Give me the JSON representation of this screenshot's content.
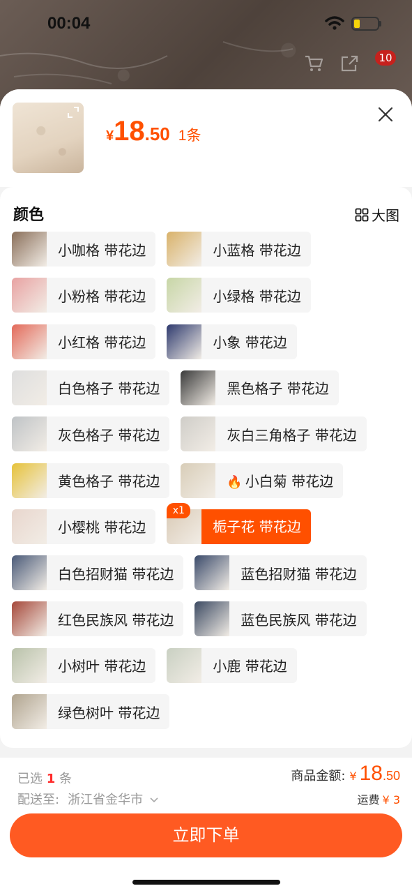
{
  "status_bar": {
    "time": "00:04"
  },
  "top_bar": {
    "cart_badge": "10"
  },
  "product": {
    "currency": "¥",
    "price_int": "18",
    "price_dec": ".50",
    "quantity_text": "1条"
  },
  "section": {
    "title": "颜色",
    "big_view_label": "大图"
  },
  "options": [
    {
      "label": "小咖格 带花边",
      "thumb": "#8a6f5a"
    },
    {
      "label": "小蓝格 带花边",
      "thumb": "#d9b26a"
    },
    {
      "label": "小粉格 带花边",
      "thumb": "#e8a2a2"
    },
    {
      "label": "小绿格 带花边",
      "thumb": "#c7d6a6"
    },
    {
      "label": "小红格 带花边",
      "thumb": "#e36a5a"
    },
    {
      "label": "小象 带花边",
      "thumb": "#2e3a6e"
    },
    {
      "label": "白色格子 带花边",
      "thumb": "#dedede"
    },
    {
      "label": "黑色格子 带花边",
      "thumb": "#3a3a3a"
    },
    {
      "label": "灰色格子 带花边",
      "thumb": "#bfc3c6"
    },
    {
      "label": "灰白三角格子 带花边",
      "thumb": "#cfcdc8"
    },
    {
      "label": "黄色格子 带花边",
      "thumb": "#e6c23a"
    },
    {
      "label": "小白菊 带花边",
      "thumb": "#d8cdb8",
      "hot": true
    },
    {
      "label": "小樱桃 带花边",
      "thumb": "#e8d6cd"
    },
    {
      "label": "栀子花 带花边",
      "thumb": "#d9cab6",
      "selected": true,
      "badge": "x1"
    },
    {
      "label": "白色招财猫 带花边",
      "thumb": "#4a5a78"
    },
    {
      "label": "蓝色招财猫 带花边",
      "thumb": "#3a4a6a"
    },
    {
      "label": "红色民族风 带花边",
      "thumb": "#a5483a"
    },
    {
      "label": "蓝色民族风 带花边",
      "thumb": "#3c4a62"
    },
    {
      "label": "小树叶 带花边",
      "thumb": "#b9c2aa"
    },
    {
      "label": "小鹿 带花边",
      "thumb": "#c9d0c2"
    },
    {
      "label": "绿色树叶 带花边",
      "thumb": "#b0a48f"
    }
  ],
  "footer": {
    "selected_prefix": "已选",
    "selected_count": "1",
    "selected_suffix": "条",
    "amount_label": "商品金额:",
    "amount_currency": "¥",
    "amount_int": "18",
    "amount_dec": ".50",
    "ship_label": "配送至:",
    "ship_address": "浙江省金华市",
    "freight_label": "运费",
    "freight_value": "¥ 3",
    "buy_label": "立即下单"
  },
  "colors": {
    "accent": "#ff5000",
    "button": "#ff5a22",
    "badge": "#c6211d"
  }
}
